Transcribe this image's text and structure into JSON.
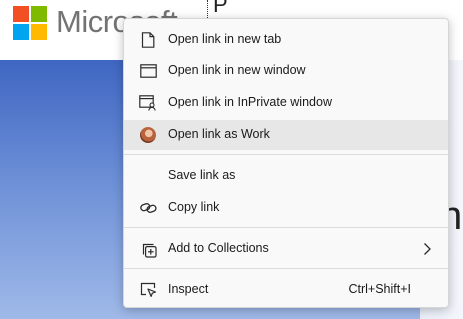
{
  "page": {
    "brand_wordmark": "Microsoft",
    "logo_colors": [
      "#f25022",
      "#7fba00",
      "#00a4ef",
      "#ffb900"
    ]
  },
  "context_menu": {
    "items": [
      {
        "label": "Open link in new tab",
        "icon": "new-tab-icon"
      },
      {
        "label": "Open link in new window",
        "icon": "new-window-icon"
      },
      {
        "label": "Open link in InPrivate window",
        "icon": "inprivate-window-icon"
      },
      {
        "label": "Open link as Work",
        "icon": "profile-avatar-icon"
      },
      {
        "label": "Save link as",
        "icon": ""
      },
      {
        "label": "Copy link",
        "icon": "link-icon"
      },
      {
        "label": "Add to Collections",
        "icon": "collections-add-icon",
        "submenu": true
      },
      {
        "label": "Inspect",
        "icon": "inspect-icon",
        "shortcut": "Ctrl+Shift+I"
      }
    ]
  }
}
